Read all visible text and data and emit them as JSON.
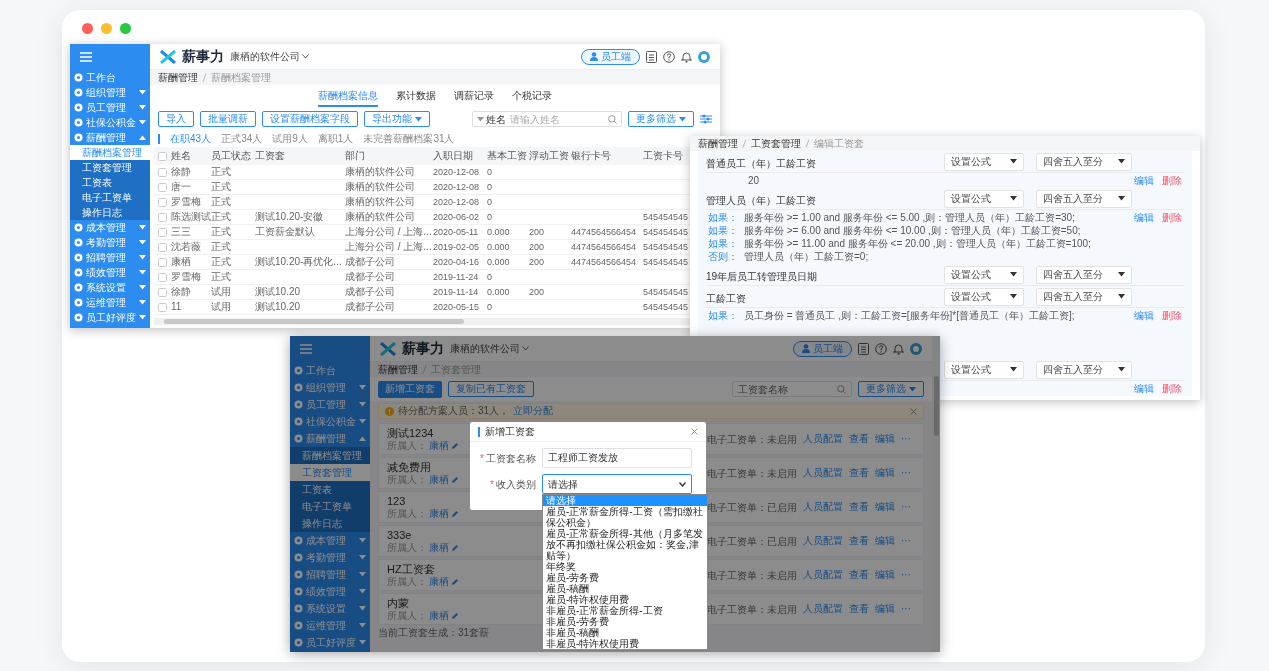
{
  "page_dots": [
    {
      "color": "#ff5f57"
    },
    {
      "color": "#febc2e"
    },
    {
      "color": "#28c840"
    }
  ],
  "salary_archive_window": {
    "sidebar": {
      "items": [
        {
          "label": "工作台",
          "kind": "link"
        },
        {
          "label": "组织管理",
          "kind": "group",
          "expanded": false
        },
        {
          "label": "员工管理",
          "kind": "group",
          "expanded": false
        },
        {
          "label": "社保公积金",
          "kind": "group",
          "expanded": false
        },
        {
          "label": "薪酬管理",
          "kind": "group",
          "expanded": true,
          "children": [
            {
              "label": "薪酬档案管理",
              "selected": true
            },
            {
              "label": "工资套管理",
              "selected": false
            },
            {
              "label": "工资表",
              "selected": false
            },
            {
              "label": "电子工资单",
              "selected": false
            },
            {
              "label": "操作日志",
              "selected": false
            }
          ]
        },
        {
          "label": "成本管理",
          "kind": "group",
          "expanded": false
        },
        {
          "label": "考勤管理",
          "kind": "group",
          "expanded": false
        },
        {
          "label": "招聘管理",
          "kind": "group",
          "expanded": false
        },
        {
          "label": "绩效管理",
          "kind": "group",
          "expanded": false
        },
        {
          "label": "系统设置",
          "kind": "group",
          "expanded": false
        },
        {
          "label": "运维管理",
          "kind": "group",
          "expanded": false
        },
        {
          "label": "员工好评度",
          "kind": "group",
          "expanded": false
        }
      ]
    },
    "header": {
      "logo": "薪事力",
      "company": "康栖的软件公司",
      "role_button": "员工端"
    },
    "breadcrumb": [
      "薪酬管理",
      "薪酬档案管理"
    ],
    "tabs": [
      {
        "label": "薪酬档案信息",
        "selected": true
      },
      {
        "label": "累计数据",
        "selected": false
      },
      {
        "label": "调薪记录",
        "selected": false
      },
      {
        "label": "个税记录",
        "selected": false
      }
    ],
    "toolbar": [
      {
        "label": "导入",
        "kind": "plain"
      },
      {
        "label": "批量调薪",
        "kind": "plain"
      },
      {
        "label": "设置薪酬档案字段",
        "kind": "plain"
      },
      {
        "label": "导出功能",
        "kind": "dropdown"
      }
    ],
    "search": {
      "field_label": "姓名",
      "placeholder": "请输入姓名"
    },
    "filter_button": "更多筛选",
    "counts": [
      {
        "label": "在职43人",
        "selected": true
      },
      {
        "label": "正式34人",
        "selected": false
      },
      {
        "label": "试用9人",
        "selected": false
      },
      {
        "label": "离职1人",
        "selected": false
      },
      {
        "label": "未完善薪酬档案31人",
        "selected": false
      }
    ],
    "table": {
      "select_all_checked": false,
      "columns": [
        "姓名",
        "员工状态",
        "工资套",
        "部门",
        "入职日期",
        "基本工资",
        "浮动工资",
        "银行卡号",
        "工资卡号"
      ],
      "rows": [
        {
          "checked": false,
          "cells": [
            "徐静",
            "正式",
            null,
            "康栖的软件公司",
            "2020-12-08",
            "0",
            null,
            null,
            null
          ]
        },
        {
          "checked": false,
          "cells": [
            "唐一",
            "正式",
            null,
            "康栖的软件公司",
            "2020-12-08",
            "0",
            null,
            null,
            null
          ]
        },
        {
          "checked": false,
          "cells": [
            "罗雪梅",
            "正式",
            null,
            "康栖的软件公司",
            "2020-12-08",
            "0",
            null,
            null,
            null
          ]
        },
        {
          "checked": false,
          "cells": [
            "陈选测试",
            "正式",
            "测试10.20-安徽",
            "康栖的软件公司",
            "2020-06-02",
            "0",
            null,
            null,
            "545454545"
          ]
        },
        {
          "checked": false,
          "cells": [
            "三三",
            "正式",
            "工资薪金默认",
            "上海分公司 / 上海...",
            "2020-05-11",
            "0.000",
            "200",
            "4474564566454",
            "545454545"
          ]
        },
        {
          "checked": false,
          "cells": [
            "沈若薇",
            "正式",
            null,
            "上海分公司 / 上海...",
            "2019-02-05",
            "0.000",
            "200",
            "4474564566454",
            "545454545"
          ]
        },
        {
          "checked": false,
          "cells": [
            "康栖",
            "正式",
            "测试10.20-再优化...",
            "成都子公司",
            "2020-04-16",
            "0.000",
            "200",
            "4474564566454",
            "545454545"
          ]
        },
        {
          "checked": false,
          "cells": [
            "罗雪梅",
            "正式",
            null,
            "成都子公司",
            "2019-11-24",
            "0",
            null,
            null,
            null
          ]
        },
        {
          "checked": false,
          "cells": [
            "徐静",
            "试用",
            "测试10.20",
            "成都子公司",
            "2019-11-14",
            "0.000",
            "200",
            null,
            "545454545"
          ]
        },
        {
          "checked": false,
          "cells": [
            "11",
            "试用",
            "测试10.20",
            "成都子公司",
            "2020-05-15",
            "0",
            null,
            null,
            "545454545"
          ]
        }
      ]
    }
  },
  "salary_set_edit_window": {
    "breadcrumb": [
      "薪酬管理",
      "工资套管理",
      "编辑工资套"
    ],
    "items": [
      {
        "name": "普通员工（年）工龄工资",
        "formula_button": "设置公式",
        "rounding": "四舍五入至分",
        "formula": [
          {
            "kind": "value",
            "text": "20"
          }
        ],
        "actions": [
          "编辑",
          "删除"
        ]
      },
      {
        "name": "管理人员（年）工龄工资",
        "formula_button": "设置公式",
        "rounding": "四舍五入至分",
        "formula": [
          {
            "kind": "if",
            "keyword": "如果：",
            "text": "服务年份 >= 1.00 and 服务年份 <= 5.00 ,则：管理人员（年）工龄工资=30;"
          },
          {
            "kind": "if",
            "keyword": "如果：",
            "text": "服务年份 >= 6.00 and 服务年份 <= 10.00 ,则：管理人员（年）工龄工资=50;"
          },
          {
            "kind": "if",
            "keyword": "如果：",
            "text": "服务年份 >= 11.00 and 服务年份 <= 20.00 ,则：管理人员（年）工龄工资=100;"
          },
          {
            "kind": "else",
            "keyword": "否则：",
            "text": "管理人员（年）工龄工资=0;"
          }
        ],
        "actions": [
          "编辑",
          "删除"
        ]
      },
      {
        "name": "19年后员工转管理员日期",
        "formula_button": "设置公式",
        "rounding": "四舍五入至分"
      },
      {
        "name": "工龄工资",
        "formula_button": "设置公式",
        "rounding": "四舍五入至分",
        "formula": [
          {
            "kind": "if",
            "keyword": "如果：",
            "text": "员工身份 = 普通员工 ,则：工龄工资=[服务年份]*[普通员工（年）工龄工资];"
          }
        ],
        "actions": [
          "编辑",
          "删除"
        ]
      },
      {
        "formula_button": "设置公式",
        "rounding": "四舍五入至分",
        "actions": [
          "编辑",
          "删除"
        ]
      }
    ]
  },
  "salary_set_window": {
    "sidebar": {
      "items": [
        {
          "label": "工作台",
          "kind": "link"
        },
        {
          "label": "组织管理",
          "kind": "group",
          "expanded": false
        },
        {
          "label": "员工管理",
          "kind": "group",
          "expanded": false
        },
        {
          "label": "社保公积金",
          "kind": "group",
          "expanded": false
        },
        {
          "label": "薪酬管理",
          "kind": "group",
          "expanded": true,
          "children": [
            {
              "label": "薪酬档案管理",
              "selected": false
            },
            {
              "label": "工资套管理",
              "selected": true
            },
            {
              "label": "工资表",
              "selected": false
            },
            {
              "label": "电子工资单",
              "selected": false
            },
            {
              "label": "操作日志",
              "selected": false
            }
          ]
        },
        {
          "label": "成本管理",
          "kind": "group",
          "expanded": false
        },
        {
          "label": "考勤管理",
          "kind": "group",
          "expanded": false
        },
        {
          "label": "招聘管理",
          "kind": "group",
          "expanded": false
        },
        {
          "label": "绩效管理",
          "kind": "group",
          "expanded": false
        },
        {
          "label": "系统设置",
          "kind": "group",
          "expanded": false
        },
        {
          "label": "运维管理",
          "kind": "group",
          "expanded": false
        },
        {
          "label": "员工好评度",
          "kind": "group",
          "expanded": false
        }
      ]
    },
    "header": {
      "logo": "薪事力",
      "company": "康栖的软件公司",
      "role_button": "员工端"
    },
    "breadcrumb": [
      "薪酬管理",
      "工资套管理"
    ],
    "buttons": [
      {
        "label": "新增工资套",
        "kind": "primary"
      },
      {
        "label": "复制已有工资套",
        "kind": "plain"
      }
    ],
    "search": {
      "placeholder": "工资套名称"
    },
    "filter_button": "更多筛选",
    "alert": {
      "text": "待分配方案人员：31人，",
      "link": "立即分配"
    },
    "cards": [
      {
        "title": "测试1234",
        "owner_label": "所属人：",
        "owner": "康栖",
        "payslip": "电子工资单：未启用",
        "actions": [
          "人员配置",
          "查看",
          "编辑",
          "···"
        ]
      },
      {
        "title": "减免费用",
        "owner_label": "所属人：",
        "owner": "康栖",
        "payslip": "电子工资单：未启用",
        "actions": [
          "人员配置",
          "查看",
          "编辑",
          "···"
        ]
      },
      {
        "title": "123",
        "owner_label": "所属人：",
        "owner": "康栖",
        "payslip": "电子工资单：已启用",
        "actions": [
          "人员配置",
          "查看",
          "编辑",
          "···"
        ]
      },
      {
        "title": "333e",
        "owner_label": "所属人：",
        "owner": "康栖",
        "payslip": "电子工资单：已启用",
        "actions": [
          "人员配置",
          "查看",
          "编辑",
          "···"
        ]
      },
      {
        "title": "HZ工资套",
        "owner_label": "所属人：",
        "owner": "康栖",
        "payslip": "电子工资单：未启用",
        "actions": [
          "人员配置",
          "查看",
          "编辑",
          "···"
        ]
      },
      {
        "title": "内蒙",
        "owner_label": "所属人：",
        "owner": "康栖",
        "payslip": "电子工资单：未启用",
        "actions": [
          "人员配置",
          "查看",
          "编辑",
          "···"
        ]
      }
    ],
    "footer": "当前工资套生成：31套薪",
    "dialog": {
      "title": "新增工资套",
      "fields": [
        {
          "label": "工资套名称",
          "required_mark": "*",
          "kind": "text",
          "value": "工程师工资发放"
        },
        {
          "label": "收入类别",
          "required_mark": "*",
          "kind": "select",
          "value": "请选择"
        }
      ],
      "options": [
        {
          "label": "请选择",
          "selected": true
        },
        {
          "label": "雇员-正常薪金所得-工资（需扣缴社保公积金）",
          "selected": false
        },
        {
          "label": "雇员-正常薪金所得-其他（月多笔发放不再扣缴社保公积金如：奖金,津贴等）",
          "selected": false
        },
        {
          "label": "年终奖",
          "selected": false
        },
        {
          "label": "雇员-劳务费",
          "selected": false
        },
        {
          "label": "雇员-稿酬",
          "selected": false
        },
        {
          "label": "雇员-特许权使用费",
          "selected": false
        },
        {
          "label": "非雇员-正常薪金所得-工资",
          "selected": false
        },
        {
          "label": "非雇员-劳务费",
          "selected": false
        },
        {
          "label": "非雇员-稿酬",
          "selected": false
        },
        {
          "label": "非雇员-特许权使用费",
          "selected": false
        }
      ]
    }
  }
}
